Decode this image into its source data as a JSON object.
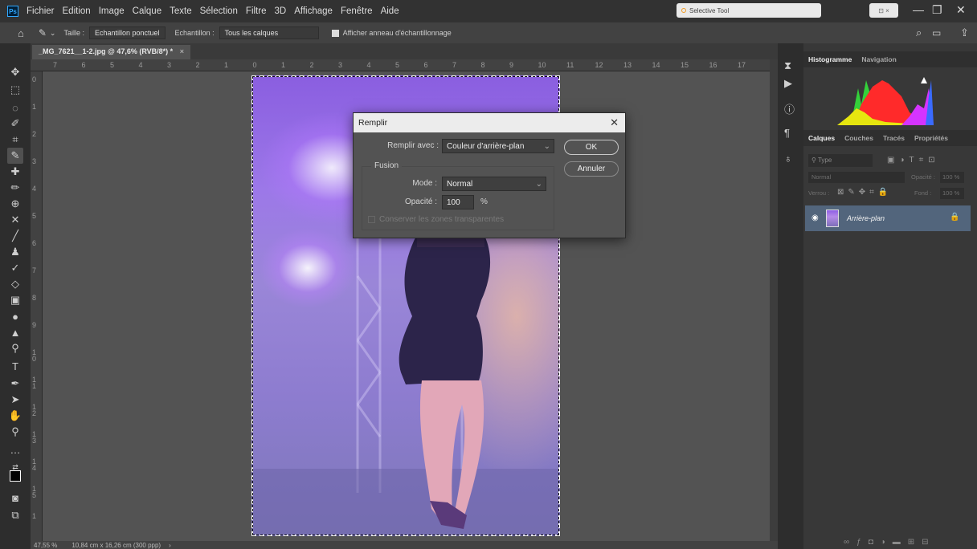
{
  "menubar": {
    "app_icon": "Ps",
    "items": [
      "Fichier",
      "Edition",
      "Image",
      "Calque",
      "Texte",
      "Sélection",
      "Filtre",
      "3D",
      "Affichage",
      "Fenêtre",
      "Aide"
    ],
    "browser_tab": "Selective Tool"
  },
  "options": {
    "taille_label": "Taille :",
    "taille_value": "Echantillon ponctuel",
    "echantillon_label": "Echantillon :",
    "echantillon_value": "Tous les calques",
    "ring_label": "Afficher anneau d'échantillonnage"
  },
  "document": {
    "tab_title": "_MG_7621__1-2.jpg @ 47,6% (RVB/8*) *",
    "ruler_h": [
      "7",
      "6",
      "5",
      "4",
      "3",
      "2",
      "1",
      "0",
      "1",
      "2",
      "3",
      "4",
      "5",
      "6",
      "7",
      "8",
      "9",
      "10",
      "11",
      "12",
      "13",
      "14",
      "15",
      "16",
      "17"
    ],
    "ruler_v": [
      "0",
      "1",
      "2",
      "3",
      "4",
      "5",
      "6",
      "7",
      "8",
      "9",
      "1 0",
      "1 1",
      "1 2",
      "1 3",
      "1 4",
      "1 5",
      "1"
    ]
  },
  "status": {
    "zoom": "47,55 %",
    "size": "10,84 cm x 16,26 cm (300 ppp)"
  },
  "panels": {
    "top_tabs": [
      "Histogramme",
      "Navigation"
    ],
    "layer_tabs": [
      "Calques",
      "Couches",
      "Tracés",
      "Propriétés"
    ],
    "search_placeholder": "Type",
    "blend_mode": "Normal",
    "opacity_label": "Opacité :",
    "opacity_value": "100 %",
    "lock_label": "Verrou :",
    "fill_label": "Fond :",
    "fill_value": "100 %",
    "layer_name": "Arrière-plan"
  },
  "dialog": {
    "title": "Remplir",
    "fill_with_label": "Remplir avec :",
    "fill_with_value": "Couleur d'arrière-plan",
    "fusion_label": "Fusion",
    "mode_label": "Mode :",
    "mode_value": "Normal",
    "opacity_label": "Opacité :",
    "opacity_value": "100",
    "opacity_unit": "%",
    "preserve_label": "Conserver les zones transparentes",
    "ok_label": "OK",
    "cancel_label": "Annuler"
  }
}
